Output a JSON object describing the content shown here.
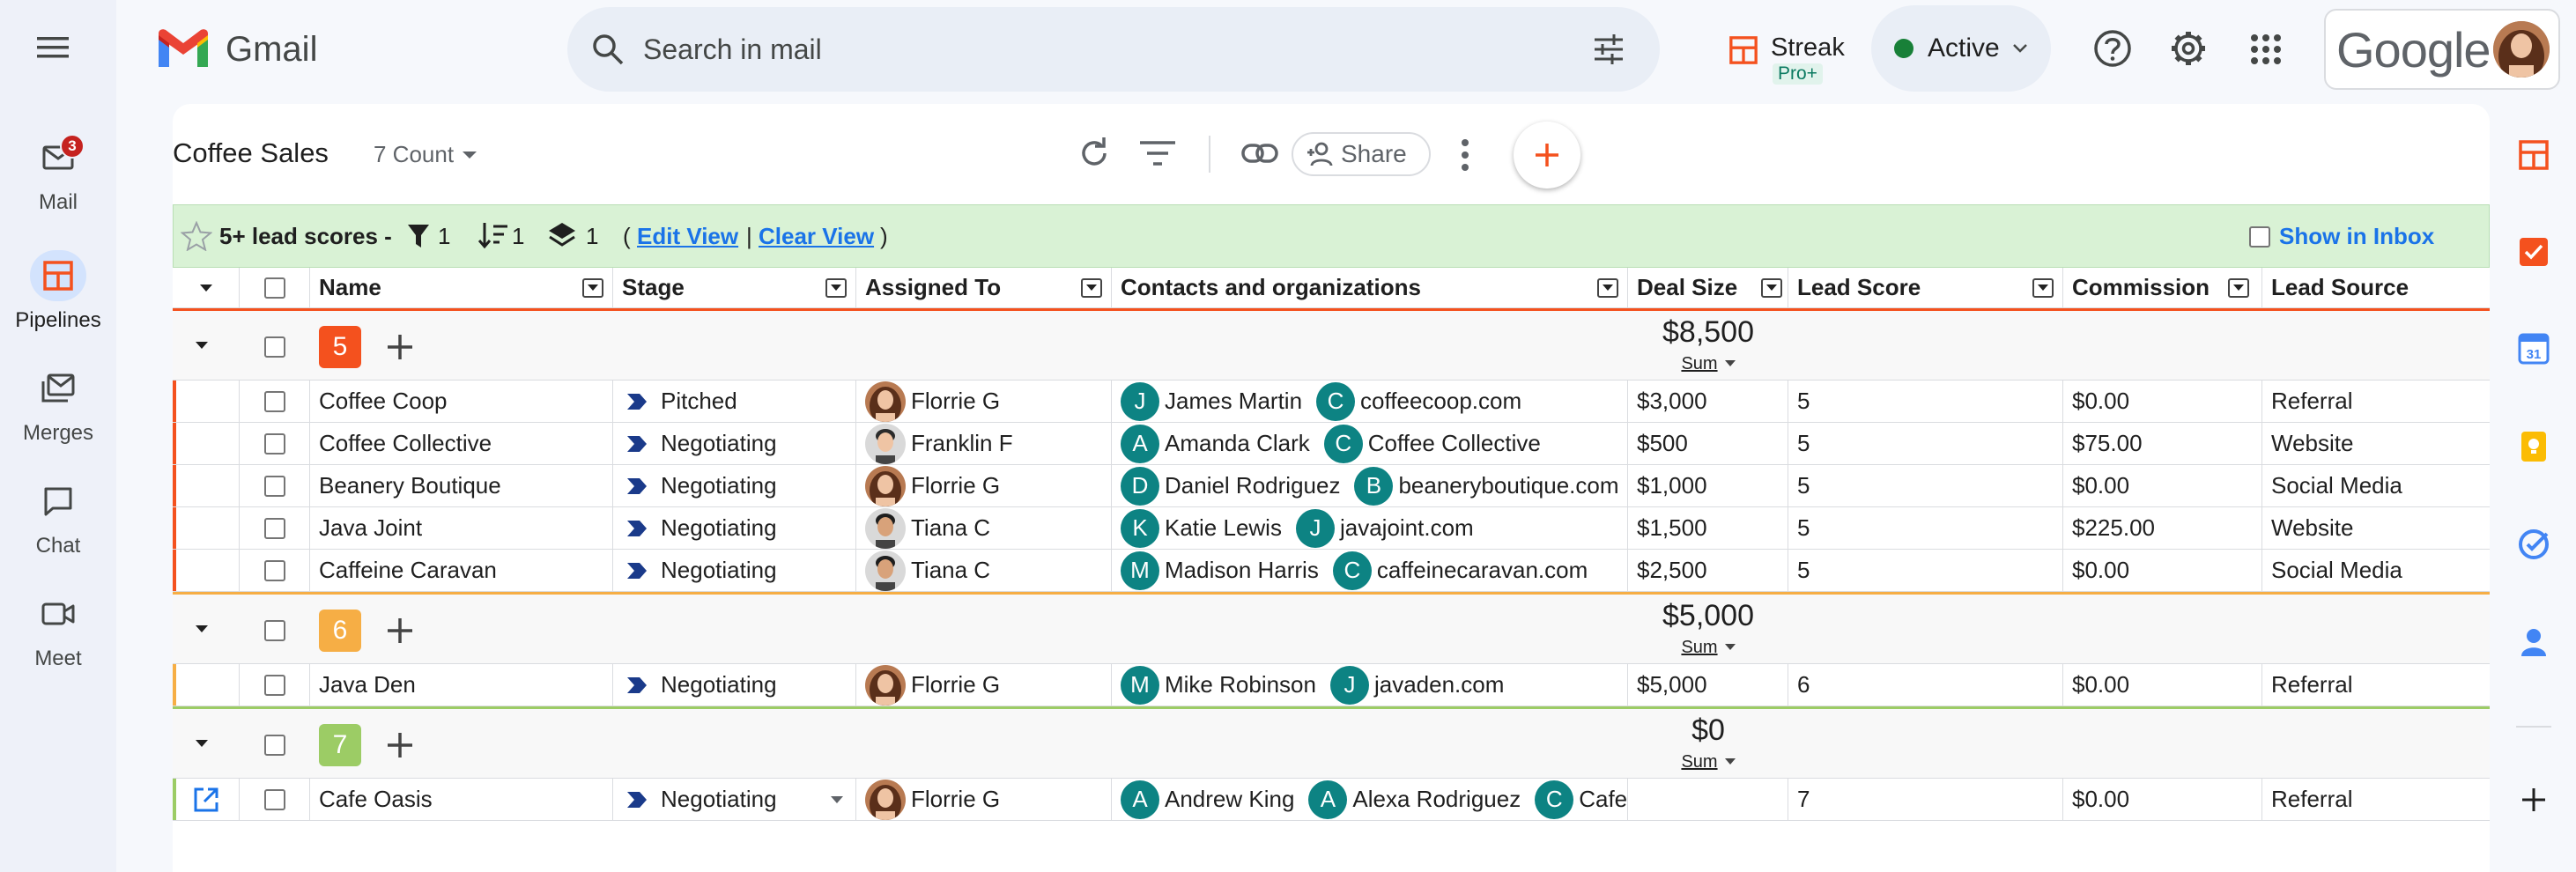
{
  "app": {
    "name": "Gmail"
  },
  "rail": {
    "items": [
      {
        "label": "Mail",
        "badge": "3"
      },
      {
        "label": "Pipelines"
      },
      {
        "label": "Merges"
      },
      {
        "label": "Chat"
      },
      {
        "label": "Meet"
      }
    ]
  },
  "search": {
    "placeholder": "Search in mail"
  },
  "streak": {
    "name": "Streak",
    "tier": "Pro+"
  },
  "status": {
    "label": "Active",
    "color": "#188038"
  },
  "account": {
    "brand": "Google"
  },
  "pipeline": {
    "title": "Coffee Sales",
    "count_label": "7 Count",
    "share_label": "Share"
  },
  "view_bar": {
    "view_name": "5+ lead scores -",
    "filter_count": "1",
    "sort_count": "1",
    "group_count": "1",
    "open_paren": "(",
    "edit_view": "Edit View",
    "separator": "|",
    "clear_view": "Clear View",
    "close_paren": ")",
    "show_in_inbox": "Show in Inbox"
  },
  "columns": [
    "Name",
    "Stage",
    "Assigned To",
    "Contacts and organizations",
    "Deal Size",
    "Lead Score",
    "Commission",
    "Lead Source"
  ],
  "groups": [
    {
      "key": "5",
      "color": "#f4511e",
      "total": "$8,500",
      "agg": "Sum",
      "rows": [
        {
          "name": "Coffee Coop",
          "stage": "Pitched",
          "assigned": "Florrie G",
          "contacts": [
            {
              "initial": "J",
              "label": "James Martin"
            },
            {
              "initial": "C",
              "label": "coffeecoop.com"
            }
          ],
          "deal": "$3,000",
          "score": "5",
          "commission": "$0.00",
          "source": "Referral"
        },
        {
          "name": "Coffee Collective",
          "stage": "Negotiating",
          "assigned": "Franklin F",
          "contacts": [
            {
              "initial": "A",
              "label": "Amanda Clark"
            },
            {
              "initial": "C",
              "label": "Coffee Collective"
            }
          ],
          "deal": "$500",
          "score": "5",
          "commission": "$75.00",
          "source": "Website"
        },
        {
          "name": "Beanery Boutique",
          "stage": "Negotiating",
          "assigned": "Florrie G",
          "contacts": [
            {
              "initial": "D",
              "label": "Daniel Rodriguez"
            },
            {
              "initial": "B",
              "label": "beaneryboutique.com"
            }
          ],
          "deal": "$1,000",
          "score": "5",
          "commission": "$0.00",
          "source": "Social Media"
        },
        {
          "name": "Java Joint",
          "stage": "Negotiating",
          "assigned": "Tiana C",
          "contacts": [
            {
              "initial": "K",
              "label": "Katie Lewis"
            },
            {
              "initial": "J",
              "label": "javajoint.com"
            }
          ],
          "deal": "$1,500",
          "score": "5",
          "commission": "$225.00",
          "source": "Website"
        },
        {
          "name": "Caffeine Caravan",
          "stage": "Negotiating",
          "assigned": "Tiana C",
          "contacts": [
            {
              "initial": "M",
              "label": "Madison Harris"
            },
            {
              "initial": "C",
              "label": "caffeinecaravan.com"
            }
          ],
          "deal": "$2,500",
          "score": "5",
          "commission": "$0.00",
          "source": "Social Media"
        }
      ]
    },
    {
      "key": "6",
      "color": "#f6ae45",
      "total": "$5,000",
      "agg": "Sum",
      "rows": [
        {
          "name": "Java Den",
          "stage": "Negotiating",
          "assigned": "Florrie G",
          "contacts": [
            {
              "initial": "M",
              "label": "Mike Robinson"
            },
            {
              "initial": "J",
              "label": "javaden.com"
            }
          ],
          "deal": "$5,000",
          "score": "6",
          "commission": "$0.00",
          "source": "Referral"
        }
      ]
    },
    {
      "key": "7",
      "color": "#9ccc65",
      "total": "$0",
      "agg": "Sum",
      "rows": [
        {
          "name": "Cafe Oasis",
          "stage": "Negotiating",
          "assigned": "Florrie G",
          "contacts": [
            {
              "initial": "A",
              "label": "Andrew King"
            },
            {
              "initial": "A",
              "label": "Alexa Rodriguez"
            },
            {
              "initial": "C",
              "label": "Cafe"
            }
          ],
          "deal": "",
          "score": "7",
          "commission": "$0.00",
          "source": "Referral"
        }
      ]
    }
  ],
  "colors": {
    "teal_chip": "#0d8383",
    "view_bar_bg": "#d9f2d5",
    "link": "#1a73e8",
    "stage_arrow": "#1a3a8a"
  }
}
